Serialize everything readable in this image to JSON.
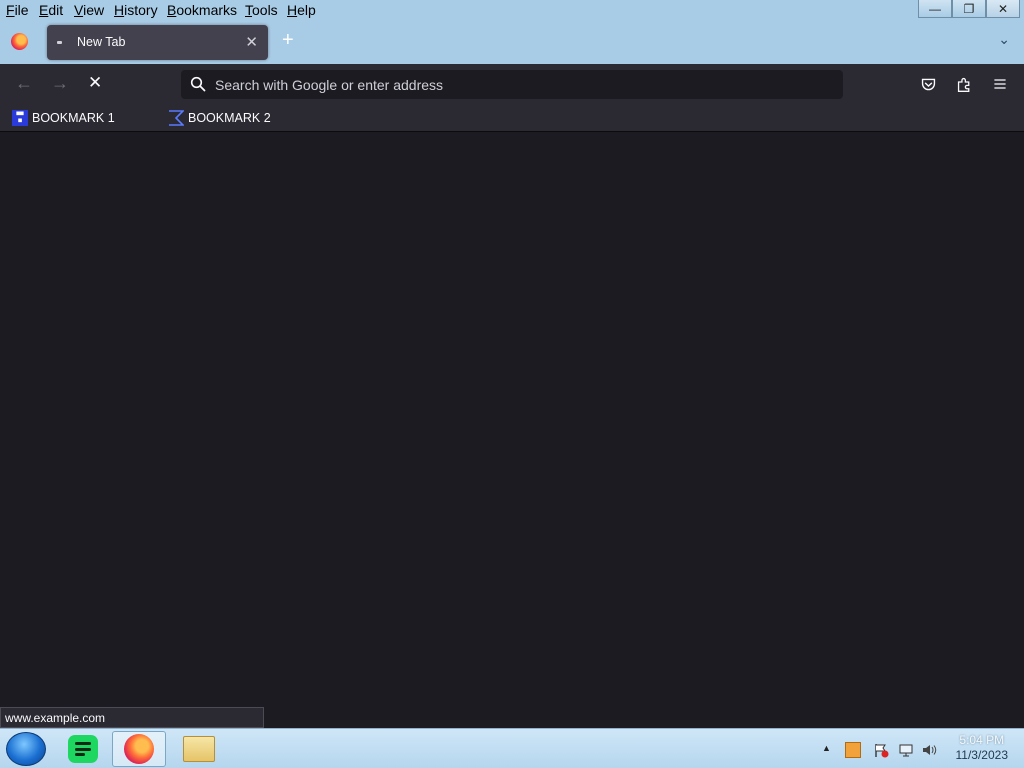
{
  "menubar": {
    "items": [
      {
        "label": "File",
        "accel": "F",
        "rest": "ile"
      },
      {
        "label": "Edit",
        "accel": "E",
        "rest": "dit"
      },
      {
        "label": "View",
        "accel": "V",
        "rest": "iew"
      },
      {
        "label": "History",
        "accel": "H",
        "rest": "istory"
      },
      {
        "label": "Bookmarks",
        "accel": "B",
        "rest": "ookmarks"
      },
      {
        "label": "Tools",
        "accel": "T",
        "rest": "ools"
      },
      {
        "label": "Help",
        "accel": "H",
        "rest": "elp"
      }
    ],
    "window_controls": {
      "minimize": "—",
      "restore": "❐",
      "close": "✕"
    }
  },
  "tabs": {
    "active": {
      "title": "New Tab",
      "close_glyph": "✕"
    },
    "new_tab_glyph": "+",
    "list_glyph": "⌄"
  },
  "navbar": {
    "back_glyph": "←",
    "forward_glyph": "→",
    "stop_glyph": "✕",
    "url_placeholder": "Search with Google or enter address",
    "url_value": "",
    "icons": [
      "pocket-icon",
      "extensions-icon",
      "menu-icon"
    ]
  },
  "bookmarks": [
    {
      "label": "BOOKMARK 1",
      "icon": "bookmark-icon-1"
    },
    {
      "label": "BOOKMARK 2",
      "icon": "bookmark-icon-2"
    }
  ],
  "status": {
    "url": "www.example.com"
  },
  "taskbar": {
    "apps": [
      "start-orb",
      "green-app-icon",
      "firefox-icon",
      "file-explorer-icon"
    ],
    "clock_time": "5:04 PM",
    "clock_date": "11/3/2023",
    "tray_chevron": "▲"
  },
  "colors": {
    "chrome_bg": "#a9cce6",
    "toolbar_bg": "#2b2a33",
    "content_bg": "#1c1b22",
    "tab_active": "#42414d",
    "text_light": "#fbfbfe"
  }
}
